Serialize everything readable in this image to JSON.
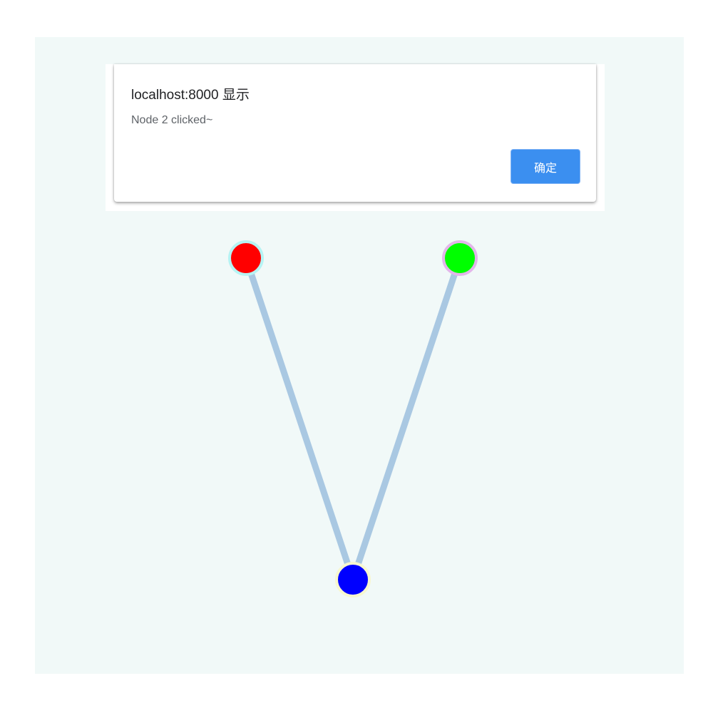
{
  "alert": {
    "title": "localhost:8000 显示",
    "message": "Node 2 clicked~",
    "ok_label": "确定"
  },
  "graph": {
    "nodes": [
      {
        "id": "node-red",
        "fill": "#ff0000",
        "ring": "#b6f3f3"
      },
      {
        "id": "node-green",
        "fill": "#00ff00",
        "ring": "#e3b6ea"
      },
      {
        "id": "node-blue",
        "fill": "#0000ff",
        "ring": "#f7f7cf"
      }
    ],
    "edge_color": "#a9c8e2"
  },
  "colors": {
    "canvas_background": "#f1f9f8",
    "button_accent": "#3b8ff0"
  }
}
